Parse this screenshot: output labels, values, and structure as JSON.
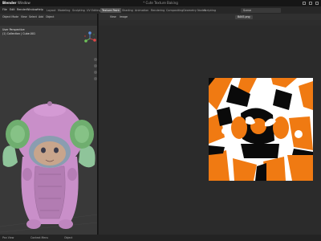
{
  "titlebar": {
    "app": "Blender",
    "window_menu": "Window",
    "file_title": "* Cute Texture Baking",
    "window_controls": [
      "minimize-icon",
      "maximize-icon",
      "close-icon"
    ]
  },
  "menubar": {
    "items": [
      "File",
      "Edit",
      "Render",
      "Window",
      "Help"
    ],
    "tabs": [
      "Layout",
      "Modeling",
      "Sculpting",
      "UV Editing",
      "Texture Paint",
      "Shading",
      "Animation",
      "Rendering",
      "Compositing",
      "Geometry Nodes",
      "Scripting"
    ],
    "active_tab": "Texture Paint",
    "scene": "Scene"
  },
  "viewport3d": {
    "header": [
      "Object Mode",
      "View",
      "Select",
      "Add",
      "Object"
    ],
    "info_line1": "User Perspective",
    "info_line2": "(1) Collection | Cube.001",
    "gizmo_axes": [
      "X",
      "Y",
      "Z"
    ],
    "colors": {
      "body": "#c98fc9",
      "ears": "#6fae6f",
      "wings": "#8fc49a",
      "face": "#8a9db0",
      "background": "#393939"
    }
  },
  "imgeditor": {
    "header": [
      "View",
      "Image"
    ],
    "image_name": "BAKE.png",
    "colors": {
      "orange": "#f07a12",
      "black": "#0a0a0a",
      "white": "#ffffff",
      "background": "#2b2b2b"
    }
  },
  "statusbar": {
    "left": "Pan View",
    "middle": "Context Menu",
    "right": "Object"
  }
}
